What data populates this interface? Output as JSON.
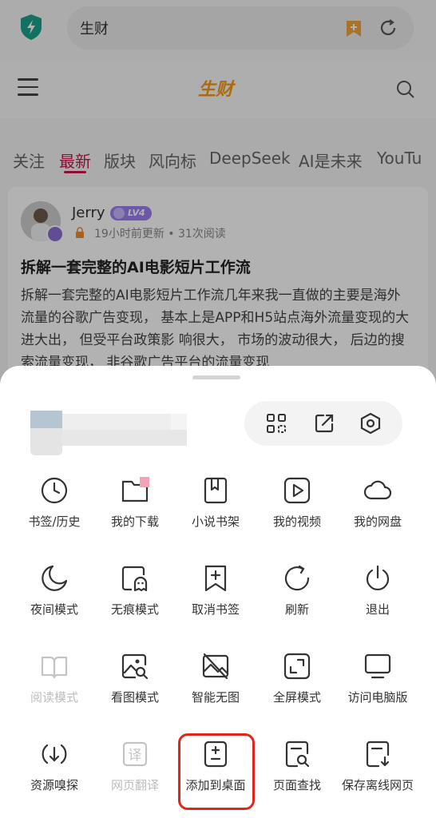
{
  "browser": {
    "address_text": "生财"
  },
  "site": {
    "logo_text": "生财",
    "tabs": [
      {
        "label": "关注"
      },
      {
        "label": "最新"
      },
      {
        "label": "版块"
      },
      {
        "label": "风向标"
      },
      {
        "label": "DeepSeek"
      },
      {
        "label": "AI是未来"
      },
      {
        "label": "YouTu"
      }
    ],
    "active_tab": "最新"
  },
  "post": {
    "author": "Jerry",
    "level": "LV4",
    "meta": "19小时前更新 • 31次阅读",
    "title": "拆解一套完整的AI电影短片工作流",
    "body": "拆解一套完整的AI电影短片工作流几年来我一直做的主要是海外流量的谷歌广告变现， 基本上是APP和H5站点海外流量变现的大进大出， 但受平台政策影 响很大， 市场的波动很大， 后边的搜索流量变现， 非谷歌广告平台的流量变现"
  },
  "menu": {
    "top_tools": [
      {
        "icon": "scan-grid-icon"
      },
      {
        "icon": "share-icon"
      },
      {
        "icon": "settings-icon"
      }
    ],
    "rows": [
      [
        {
          "label": "书签/历史",
          "icon": "clock-icon",
          "enabled": true
        },
        {
          "label": "我的下载",
          "icon": "folder-icon",
          "enabled": true
        },
        {
          "label": "小说书架",
          "icon": "book-bookmark-icon",
          "enabled": true
        },
        {
          "label": "我的视频",
          "icon": "play-icon",
          "enabled": true
        },
        {
          "label": "我的网盘",
          "icon": "cloud-icon",
          "enabled": true
        }
      ],
      [
        {
          "label": "夜间模式",
          "icon": "moon-icon",
          "enabled": true
        },
        {
          "label": "无痕模式",
          "icon": "ghost-icon",
          "enabled": true
        },
        {
          "label": "取消书签",
          "icon": "bookmark-add-icon",
          "enabled": true
        },
        {
          "label": "刷新",
          "icon": "refresh-icon",
          "enabled": true
        },
        {
          "label": "退出",
          "icon": "power-icon",
          "enabled": true
        }
      ],
      [
        {
          "label": "阅读模式",
          "icon": "open-book-icon",
          "enabled": false
        },
        {
          "label": "看图模式",
          "icon": "image-view-icon",
          "enabled": true
        },
        {
          "label": "智能无图",
          "icon": "no-image-icon",
          "enabled": true
        },
        {
          "label": "全屏模式",
          "icon": "fullscreen-icon",
          "enabled": true
        },
        {
          "label": "访问电脑版",
          "icon": "monitor-icon",
          "enabled": true
        }
      ],
      [
        {
          "label": "资源嗅探",
          "icon": "antenna-icon",
          "enabled": true
        },
        {
          "label": "网页翻译",
          "icon": "translate-icon",
          "enabled": false
        },
        {
          "label": "添加到桌面",
          "icon": "add-to-desktop-icon",
          "enabled": true
        },
        {
          "label": "页面查找",
          "icon": "page-search-icon",
          "enabled": true
        },
        {
          "label": "保存离线网页",
          "icon": "save-offline-icon",
          "enabled": true
        }
      ]
    ],
    "highlighted_item": "添加到桌面"
  }
}
